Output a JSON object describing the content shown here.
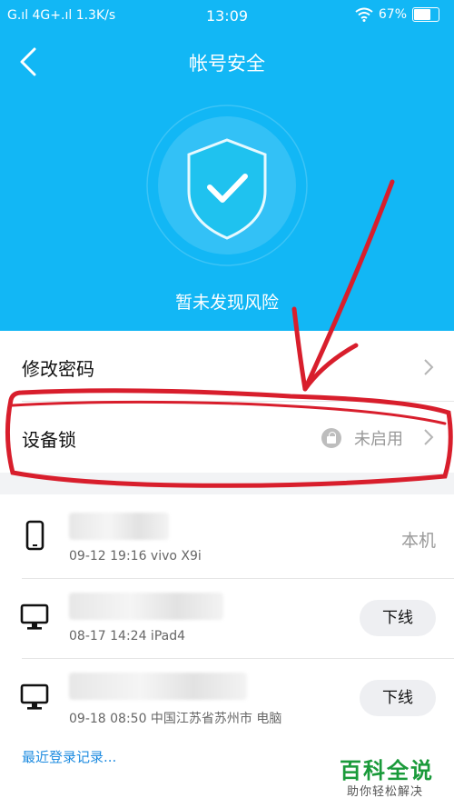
{
  "status_bar": {
    "left": "G.ıl 4G+.ıl 1.3K/s",
    "time": "13:09",
    "battery": "67%"
  },
  "header": {
    "title": "帐号安全"
  },
  "hero": {
    "risk_text": "暂未发现风险"
  },
  "settings": {
    "change_password": "修改密码",
    "device_lock": "设备锁",
    "device_lock_status": "未启用"
  },
  "devices": [
    {
      "info": "09-12 19:16 vivo X9i",
      "action": "本机",
      "icon": "phone-icon"
    },
    {
      "info": "08-17 14:24 iPad4",
      "action": "下线",
      "icon": "monitor-icon"
    },
    {
      "info": "09-18 08:50 中国江苏省苏州市 电脑",
      "action": "下线",
      "icon": "monitor-icon"
    }
  ],
  "recent_login_link": "最近登录记录...",
  "watermark": {
    "title": "百科全说",
    "subtitle": "助你轻松解决"
  },
  "colors": {
    "header_blue": "#12b7f5",
    "annotation_red": "#d81e2c",
    "link_blue": "#1f8ce0"
  }
}
